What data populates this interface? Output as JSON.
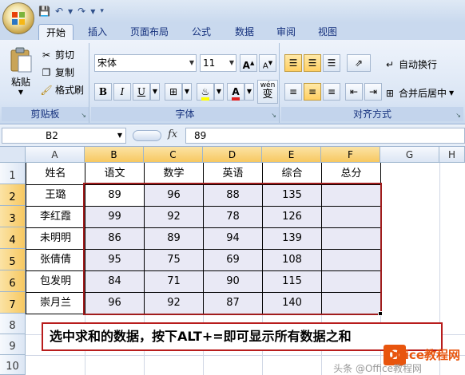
{
  "quick_access": {
    "save_icon": "save-icon",
    "undo_icon": "undo-icon",
    "redo_icon": "redo-icon",
    "customize_icon": "customize-icon"
  },
  "tabs": [
    "开始",
    "插入",
    "页面布局",
    "公式",
    "数据",
    "审阅",
    "视图"
  ],
  "clipboard": {
    "paste": "粘贴",
    "cut": "剪切",
    "copy": "复制",
    "format_painter": "格式刷",
    "label": "剪贴板"
  },
  "font": {
    "name": "宋体",
    "size": "11",
    "grow": "A",
    "shrink": "A",
    "bold": "B",
    "italic": "I",
    "underline": "U",
    "label": "字体",
    "phonetic": "wén",
    "phonetic_char": "变"
  },
  "alignment": {
    "wrap_text": "自动换行",
    "merge_center": "合并后居中",
    "label": "对齐方式"
  },
  "formula_bar": {
    "name_box": "B2",
    "fx": "fx",
    "value": "89"
  },
  "columns": [
    "A",
    "B",
    "C",
    "D",
    "E",
    "F",
    "G",
    "H"
  ],
  "rows": [
    "1",
    "2",
    "3",
    "4",
    "5",
    "6",
    "7",
    "8",
    "9",
    "10"
  ],
  "table": {
    "header": [
      "姓名",
      "语文",
      "数学",
      "英语",
      "综合",
      "总分"
    ],
    "rows": [
      [
        "王璐",
        "89",
        "96",
        "88",
        "135",
        ""
      ],
      [
        "李红霞",
        "99",
        "92",
        "78",
        "126",
        ""
      ],
      [
        "未明明",
        "86",
        "89",
        "94",
        "139",
        ""
      ],
      [
        "张倩倩",
        "95",
        "75",
        "69",
        "108",
        ""
      ],
      [
        "包发明",
        "84",
        "71",
        "90",
        "115",
        ""
      ],
      [
        "崇月兰",
        "96",
        "92",
        "87",
        "140",
        ""
      ]
    ]
  },
  "note": "选中求和的数据，按下ALT+=即可显示所有数据之和",
  "watermark": {
    "logo_letter": "O",
    "brand": "Office教程网",
    "author": "头条 @Office教程网"
  },
  "colors": {
    "selection_border": "#a01c1c",
    "note_border": "#b81c1c",
    "brand": "#e8550e"
  }
}
